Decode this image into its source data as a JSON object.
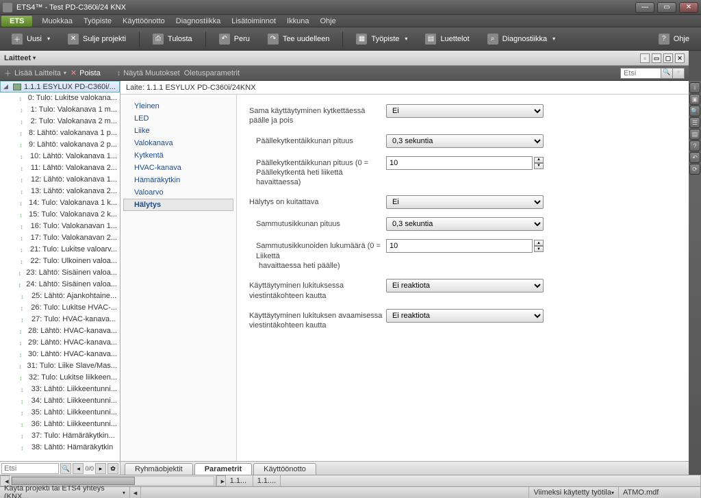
{
  "titlebar": {
    "title": "ETS4™ - Test PD-C360i/24 KNX"
  },
  "menubar": {
    "ets": "ETS",
    "items": [
      "Muokkaa",
      "Työpiste",
      "Käyttöönotto",
      "Diagnostiikka",
      "Lisätoiminnot",
      "Ikkuna",
      "Ohje"
    ]
  },
  "toolbar": {
    "uusi": "Uusi",
    "sulje": "Sulje projekti",
    "tulosta": "Tulosta",
    "peru": "Peru",
    "tee": "Tee uudelleen",
    "tyopiste": "Työpiste",
    "luettelot": "Luettelot",
    "diag": "Diagnostiikka",
    "ohje": "Ohje"
  },
  "panel": {
    "title": "Laitteet"
  },
  "subbar": {
    "lisaa": "Lisää Laitteita",
    "poista": "Poista",
    "nayta": "Näytä Muutokset",
    "oletus": "Oletusparametrit",
    "search_ph": "Etsi"
  },
  "tree": {
    "root": "1.1.1 ESYLUX PD-C360i/...",
    "items": [
      "0: Tulo: Lukitse valokana...",
      "1: Tulo: Valokanava 1 m...",
      "2: Tulo: Valokanava 2 m...",
      "8: Lähtö: valokanava 1 p...",
      "9: Lähtö: valokanava 2 p...",
      "10: Lähtö: Valokanava 1...",
      "11: Lähtö: Valokanava 2...",
      "12: Lähtö: valokanava 1...",
      "13: Lähtö: valokanava 2...",
      "14: Tulo: Valokanava 1 k...",
      "15: Tulo: Valokanava 2 k...",
      "16: Tulo: Valokanavan 1...",
      "17: Tulo: Valokanavan 2...",
      "21: Tulo: Lukitse valoarv...",
      "22: Tulo: Ulkoinen valoa...",
      "23: Lähtö: Sisäinen valoa...",
      "24: Lähtö: Sisäinen valoa...",
      "25: Lähtö: Ajankohtaine...",
      "26: Tulo: Lukitse HVAC-...",
      "27: Tulo: HVAC-kanava...",
      "28: Lähtö: HVAC-kanava...",
      "29: Lähtö: HVAC-kanava...",
      "30: Lähtö: HVAC-kanava...",
      "31: Tulo: Liike Slave/Mas...",
      "32: Tulo: Lukitse liikkeen...",
      "33: Lähtö: Liikkeentunni...",
      "34: Lähtö: Liikkeentunni...",
      "35: Lähtö: Liikkeentunni...",
      "36: Lähtö: Liikkeentunni...",
      "37: Tulo: Hämäräkytkin...",
      "38: Lähtö: Hämäräkytkin"
    ]
  },
  "left_search": {
    "ph": "Etsi",
    "count": "0/0"
  },
  "device_header": "Laite: 1.1.1  ESYLUX PD-C360i/24KNX",
  "param_nav": [
    "Yleinen",
    "LED",
    "Liike",
    "Valokanava",
    "Kytkentä",
    "HVAC-kanava",
    "Hämäräkytkin",
    "Valoarvo",
    "Hälytys"
  ],
  "param_nav_selected": 8,
  "form": {
    "r1_lbl": "Sama käyttäytyminen kytkettäessä päälle ja pois",
    "r1_val": "Ei",
    "r2_lbl": "Päällekytkentäikkunan pituus",
    "r2_val": "0,3 sekuntia",
    "r3_lbl": "Päällekytkentäikkunan pituus (0 = Päällekytkentä heti liikettä havaittaessa)",
    "r3_val": "10",
    "r4_lbl": "Hälytys on kuitattava",
    "r4_val": "Ei",
    "r5_lbl": "Sammutusikkunan pituus",
    "r5_val": "0,3 sekuntia",
    "r6_lbl": "Sammutusikkunoiden lukumäärä (0 = Liikettä",
    "r6_lbl2": "havaittaessa heti päälle)",
    "r6_val": "10",
    "r7_lbl": "Käyttäytyminen lukituksessa viestintäkohteen kautta",
    "r7_val": "Ei reaktiota",
    "r8_lbl": "Käyttäytyminen lukituksen avaamisessa viestintäkohteen kautta",
    "r8_val": "Ei reaktiota"
  },
  "bottom_tabs": {
    "t1": "Ryhmäobjektit",
    "t2": "Parametrit",
    "t3": "Käyttöönotto"
  },
  "status1": {
    "a": "1.1...",
    "b": "1.1...."
  },
  "status2": {
    "left": "Käytä projekti tai ETS4 yhteys (KNX...",
    "mid": "Viimeksi käytetty työtila",
    "right": "ATMO.mdf"
  }
}
